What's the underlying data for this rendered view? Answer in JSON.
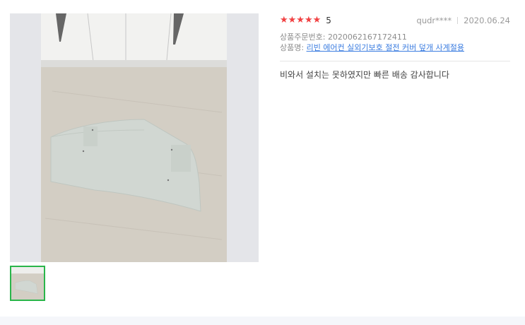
{
  "review": {
    "stars": "★★★★★",
    "score": "5",
    "user": "qudr****",
    "date": "2020.06.24",
    "order_label": "상품주문번호:",
    "order_number": "2020062167172411",
    "product_label": "상품명:",
    "product_name": "리빈 에어컨 실외기보호 절전 커버 덮개 사계절용",
    "text": "비와서 설치는 못하였지만 빠른 배송 감사합니다"
  },
  "colors": {
    "star": "#f14142",
    "link": "#3a7ce0",
    "thumb_border": "#2ab54a"
  }
}
